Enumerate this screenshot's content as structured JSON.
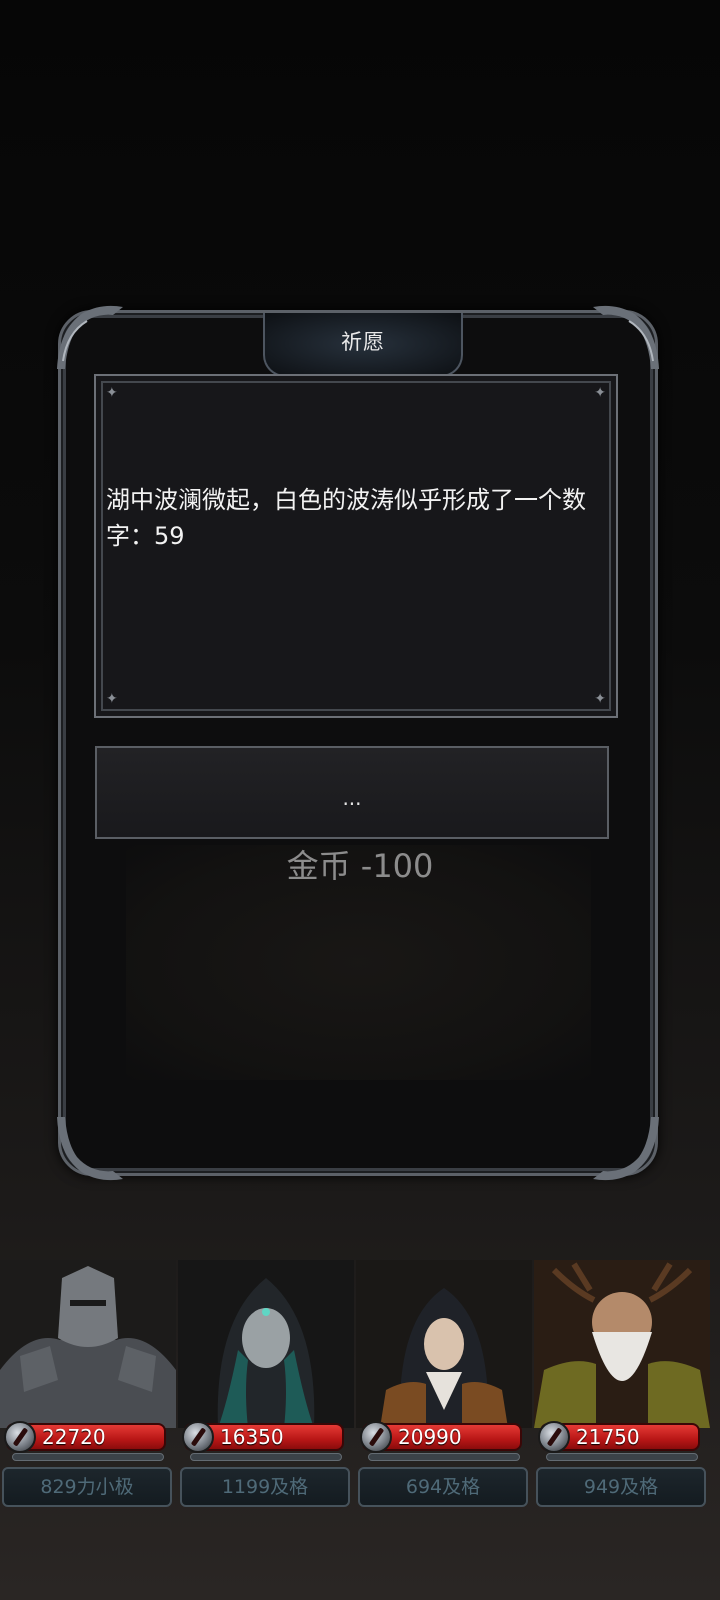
{
  "dialog": {
    "title": "祈愿",
    "event_text": "湖中波澜微起，白色的波涛似乎形成了一个数字：59",
    "choice_label": "...",
    "cost_label": "金币 -100"
  },
  "heroes": [
    {
      "hp": "22720",
      "score": "829力小极",
      "portrait": "armored-knight"
    },
    {
      "hp": "16350",
      "score": "1199及格",
      "portrait": "hooded-sorceress"
    },
    {
      "hp": "20990",
      "score": "694及格",
      "portrait": "nun"
    },
    {
      "hp": "21750",
      "score": "949及格",
      "portrait": "antlered-elder"
    }
  ]
}
